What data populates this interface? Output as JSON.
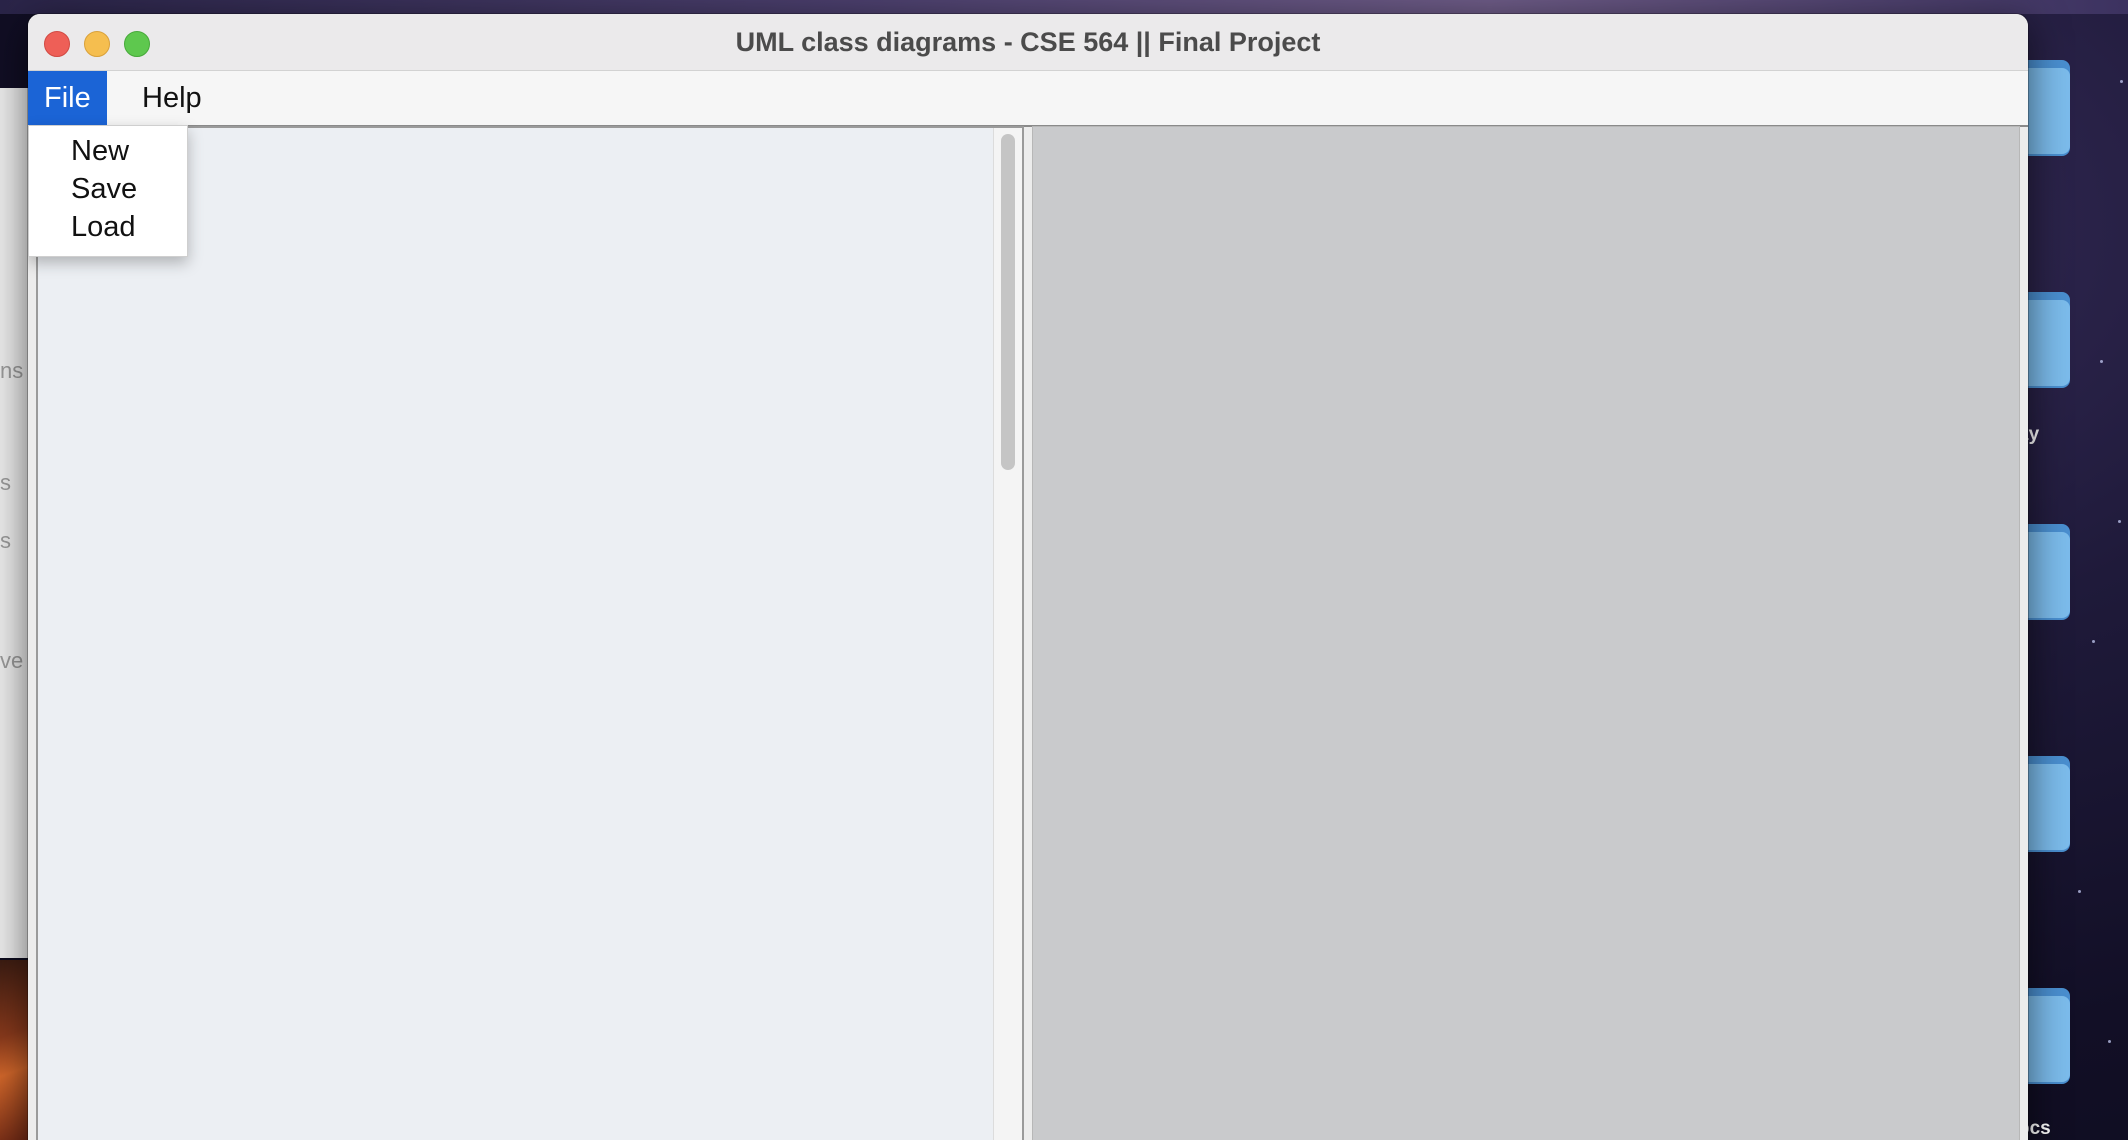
{
  "window": {
    "title": "UML class diagrams - CSE 564 || Final Project"
  },
  "menubar": {
    "items": [
      {
        "label": "File"
      },
      {
        "label": "Help"
      }
    ]
  },
  "file_menu": {
    "items": [
      {
        "label": "New"
      },
      {
        "label": "Save"
      },
      {
        "label": "Load"
      }
    ]
  },
  "background": {
    "left_window_fragments": [
      "ns",
      "s",
      "s",
      "ve"
    ],
    "desktop_labels": [
      "ay",
      "ocs"
    ]
  },
  "colors": {
    "menu_highlight": "#1b64d6",
    "left_pane": "#eceff3",
    "right_pane": "#c9cacc",
    "close": "#ee5f57",
    "minimize": "#f5be4f",
    "maximize": "#5ec84e"
  }
}
